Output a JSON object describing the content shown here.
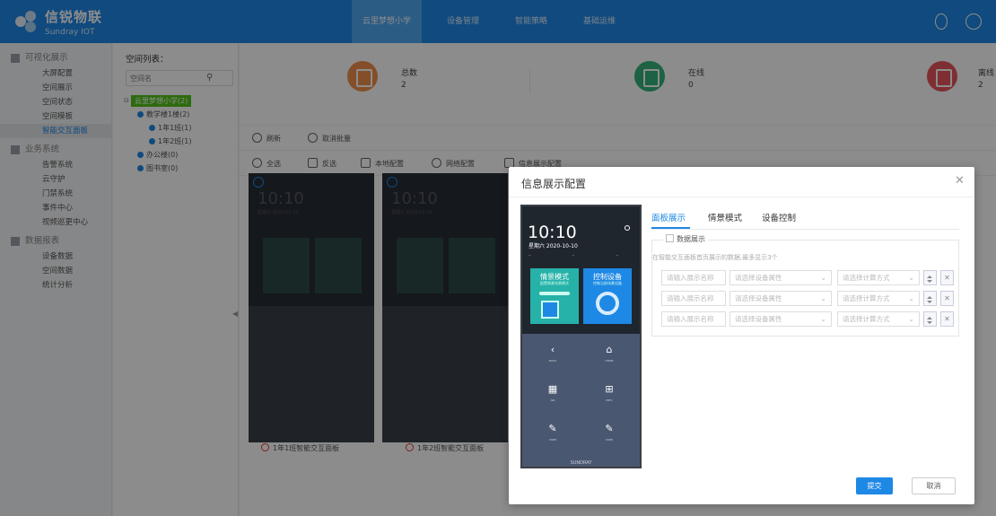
{
  "brand": {
    "name_cn": "信锐物联",
    "name_en": "Sundray IOT"
  },
  "nav": [
    "云里梦想小学",
    "设备管理",
    "智能策略",
    "基础运维"
  ],
  "sidebar": {
    "groups": [
      {
        "label": "可视化展示",
        "items": [
          "大屏配置",
          "空间展示",
          "空间状态",
          "空间模板",
          "智能交互面板"
        ]
      },
      {
        "label": "业务系统",
        "items": [
          "告警系统",
          "云守护",
          "门禁系统",
          "事件中心",
          "视频巡更中心"
        ]
      },
      {
        "label": "数据报表",
        "items": [
          "设备数据",
          "空间数据",
          "统计分析"
        ]
      }
    ],
    "active": "智能交互面板"
  },
  "space_tree": {
    "title": "空间列表：",
    "search_placeholder": "空间名",
    "nodes": [
      "云里梦想小学(2)",
      "教学楼1楼(2)",
      "1年1班(1)",
      "1年2班(1)",
      "办公楼(0)",
      "图书室(0)"
    ]
  },
  "stats": [
    {
      "label": "总数",
      "value": "2",
      "color": "#f0904a"
    },
    {
      "label": "在线",
      "value": "0",
      "color": "#34b37a"
    },
    {
      "label": "离线",
      "value": "2",
      "color": "#e8545c"
    }
  ],
  "toolbar1": [
    "刷新",
    "取消批量"
  ],
  "toolbar2": [
    "全选",
    "反选",
    "本地配置",
    "网络配置",
    "信息展示配置"
  ],
  "cards": [
    {
      "time": "10:10",
      "date": "星期六 2020-10-10",
      "label": "1年1班智能交互面板"
    },
    {
      "time": "10:10",
      "date": "星期六 2020-10-10",
      "label": "1年2班智能交互面板"
    }
  ],
  "modal": {
    "title": "信息展示配置",
    "preview": {
      "time": "10:10",
      "date": "星期六 2020-10-10",
      "tile1_title": "情景模式",
      "tile1_sub": "配置情景场景模式",
      "tile2_title": "控制设备",
      "tile2_sub": "控制当前场景设备",
      "grid": [
        {
          "label": "BACK"
        },
        {
          "label": "HOME"
        },
        {
          "label": "AIR"
        },
        {
          "label": "INFO"
        },
        {
          "label": "USER"
        },
        {
          "label": "USER"
        }
      ],
      "footer": "SUNDRAY"
    },
    "tabs": [
      "面板展示",
      "情景模式",
      "设备控制"
    ],
    "checkbox_label": "数据展示",
    "hint": "在智能交互面板首页展示的数据,最多显示3个",
    "row_placeholders": {
      "name": "请输入展示名称",
      "attr": "请选择设备属性",
      "calc": "请选择计算方式"
    },
    "submit": "提交",
    "cancel": "取消"
  }
}
